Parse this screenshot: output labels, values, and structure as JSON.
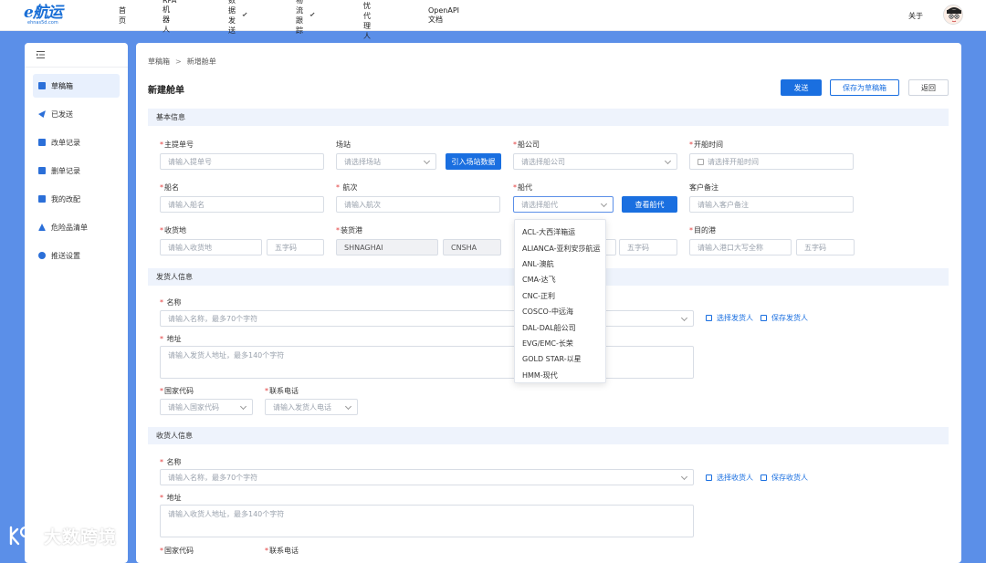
{
  "colors": {
    "accent": "#1a6fe0",
    "background": "#5b8fe8",
    "required": "#e23c3c",
    "section_bg": "#eef3fc"
  },
  "topbar": {
    "logo_mark": "e航运",
    "logo_sub": "ehnas5d.com",
    "nav": [
      {
        "label": "首页",
        "has_caret": false
      },
      {
        "label": "RPA机器人",
        "has_caret": false
      },
      {
        "label": "数据发送",
        "has_caret": true
      },
      {
        "label": "物流跟踪",
        "has_caret": true
      },
      {
        "label": "无忧代理人",
        "has_caret": false
      },
      {
        "label": "OpenAPI文档",
        "has_caret": false
      }
    ],
    "about": "关于"
  },
  "sidebar": {
    "toggle_icon": "menu-fold-icon",
    "items": [
      {
        "label": "草稿箱",
        "icon": "draft-icon",
        "active": true
      },
      {
        "label": "已发送",
        "icon": "send-icon",
        "active": false
      },
      {
        "label": "改单记录",
        "icon": "edit-record-icon",
        "active": false
      },
      {
        "label": "删单记录",
        "icon": "delete-record-icon",
        "active": false
      },
      {
        "label": "我的改配",
        "icon": "reassign-icon",
        "active": false
      },
      {
        "label": "危险品清单",
        "icon": "hazard-icon",
        "active": false
      },
      {
        "label": "推送设置",
        "icon": "settings-icon",
        "active": false
      }
    ]
  },
  "breadcrumb": {
    "parent": "草稿箱",
    "separator": ">",
    "current": "新增舱单"
  },
  "page_title": "新建舱单",
  "actions": {
    "send": "发送",
    "save_draft": "保存为草稿箱",
    "back": "返回"
  },
  "basic": {
    "section": "基本信息",
    "bl_no": {
      "label": "主提单号",
      "placeholder": "请输入提单号"
    },
    "yard": {
      "label": "场站",
      "placeholder": "请选择场站"
    },
    "import_yard": "引入场站数据",
    "carrier": {
      "label": "船公司",
      "placeholder": "请选择船公司"
    },
    "sail_time": {
      "label": "开船时间",
      "placeholder": "请选择开船时间"
    },
    "vessel": {
      "label": "船名",
      "placeholder": "请输入船名"
    },
    "voyage": {
      "label": "航次",
      "placeholder": "请输入航次"
    },
    "agent": {
      "label": "船代",
      "placeholder": "请选择船代"
    },
    "view_agent": "查看船代",
    "remark": {
      "label": "客户备注",
      "placeholder": "请输入客户备注"
    },
    "receipt": {
      "label": "收货地",
      "placeholder": "请输入收货地",
      "code_placeholder": "五字码"
    },
    "loading_port": {
      "label": "装货港",
      "name_value": "SHNAGHAI",
      "code_value": "CNSHA"
    },
    "discharge_code_placeholder": "五字码",
    "destination": {
      "label": "目的港",
      "placeholder": "请输入港口大写全称",
      "code_placeholder": "五字码"
    }
  },
  "agent_dropdown": [
    "ACL-大西洋箱运",
    "ALIANCA-亚利安莎航运",
    "ANL-澳航",
    "CMA-达飞",
    "CNC-正利",
    "COSCO-中远海",
    "DAL-DAL船公司",
    "EVG/EMC-长荣",
    "GOLD STAR-以星",
    "HMM-现代"
  ],
  "shipper": {
    "section": "发货人信息",
    "name": {
      "label": "名称",
      "placeholder": "请输入名称，最多70个字符"
    },
    "select_link": "选择发货人",
    "save_link": "保存发货人",
    "address": {
      "label": "地址",
      "placeholder": "请输入发货人地址，最多140个字符"
    },
    "country": {
      "label": "国家代码",
      "placeholder": "请输入国家代码"
    },
    "phone": {
      "label": "联系电话",
      "placeholder": "请输入发货人电话"
    }
  },
  "consignee": {
    "section": "收货人信息",
    "name": {
      "label": "名称",
      "placeholder": "请输入名称，最多70个字符"
    },
    "select_link": "选择收货人",
    "save_link": "保存收货人",
    "address": {
      "label": "地址",
      "placeholder": "请输入收货人地址，最多140个字符"
    },
    "country": {
      "label": "国家代码"
    },
    "phone": {
      "label": "联系电话"
    }
  },
  "watermark": "大数跨境"
}
